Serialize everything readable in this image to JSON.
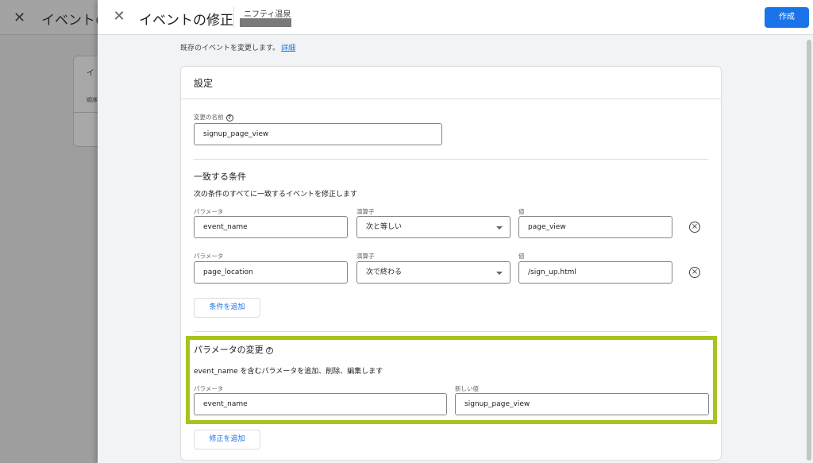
{
  "background": {
    "title": "イベントの",
    "card_label_1": "イ",
    "card_label_2": "順序"
  },
  "header": {
    "title": "イベントの修正",
    "property_name": "ニフティ温泉",
    "create_label": "作成"
  },
  "intro": {
    "text": "既存のイベントを変更します。",
    "link": "詳細"
  },
  "settings": {
    "title": "設定",
    "name_label": "変更の名前",
    "name_value": "signup_page_view"
  },
  "conditions": {
    "title": "一致する条件",
    "description": "次の条件のすべてに一致するイベントを修正します",
    "param_label": "パラメータ",
    "operator_label": "演算子",
    "value_label": "値",
    "rows": [
      {
        "parameter": "event_name",
        "operator": "次と等しい",
        "value": "page_view"
      },
      {
        "parameter": "page_location",
        "operator": "次で終わる",
        "value": "/sign_up.html"
      }
    ],
    "add_label": "条件を追加"
  },
  "param_changes": {
    "title": "パラメータの変更",
    "description": "event_name を含むパラメータを追加、削除、編集します",
    "param_label": "パラメータ",
    "new_value_label": "新しい値",
    "parameter": "event_name",
    "new_value": "signup_page_view",
    "add_label": "修正を追加"
  },
  "icons": {
    "close": "close-icon",
    "help": "help-icon",
    "remove": "remove-circle-icon",
    "dropdown": "chevron-down-icon"
  },
  "colors": {
    "primary": "#1a73e8",
    "highlight": "#a5c41c"
  }
}
